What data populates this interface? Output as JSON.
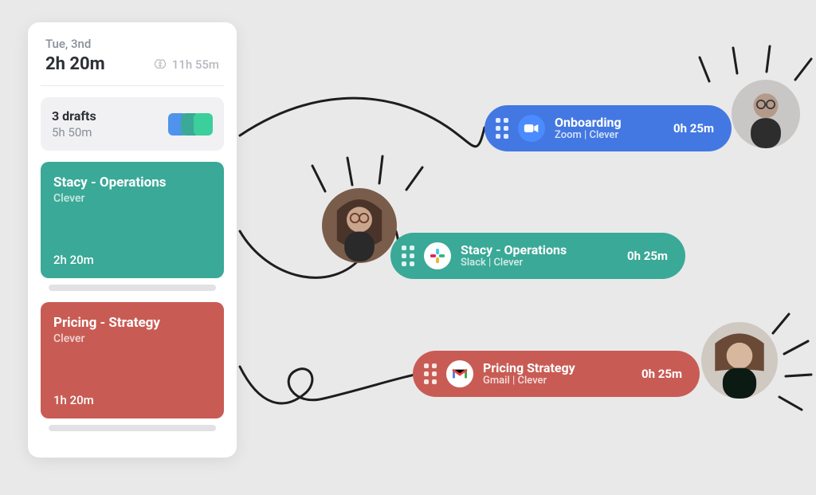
{
  "card": {
    "date": "Tue, 3nd",
    "primary_time": "2h 20m",
    "meta_time": "11h 55m",
    "drafts": {
      "title": "3 drafts",
      "subtitle": "5h 50m"
    },
    "blocks": [
      {
        "title": "Stacy - Operations",
        "subtitle": "Clever",
        "time": "2h 20m",
        "color": "teal"
      },
      {
        "title": "Pricing - Strategy",
        "subtitle": "Clever",
        "time": "1h 20m",
        "color": "red"
      }
    ]
  },
  "pills": [
    {
      "title": "Onboarding",
      "subtitle": "Zoom | Clever",
      "time": "0h 25m",
      "app": "zoom",
      "color": "blue"
    },
    {
      "title": "Stacy - Operations",
      "subtitle": "Slack | Clever",
      "time": "0h 25m",
      "app": "slack",
      "color": "teal"
    },
    {
      "title": "Pricing Strategy",
      "subtitle": "Gmail | Clever",
      "time": "0h 25m",
      "app": "gmail",
      "color": "red"
    }
  ],
  "icons": {
    "brain": "brain-icon",
    "grip": "grip-icon"
  }
}
